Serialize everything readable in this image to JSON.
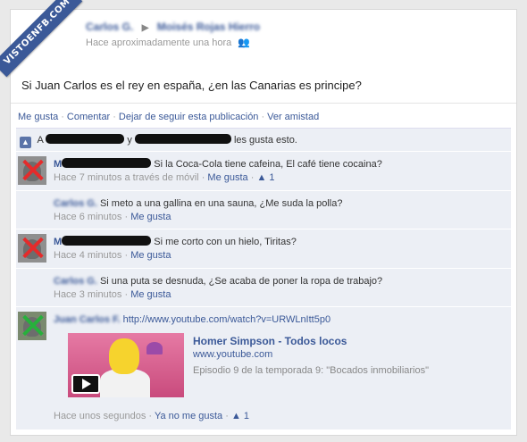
{
  "watermark": "VISTOENFB.COM",
  "post": {
    "author": "Carlos G.",
    "arrow": "▶",
    "target": "Moisés Rojas Hierro",
    "time": "Hace aproximadamente una hora",
    "status": "Si Juan Carlos es el rey en españa, ¿en las Canarias es principe?"
  },
  "actions": [
    "Me gusta",
    "Comentar",
    "Dejar de seguir esta publicación",
    "Ver amistad"
  ],
  "likes": {
    "prefix": "A",
    "joiner": "y",
    "suffix": "les gusta esto."
  },
  "comments": [
    {
      "author": "M",
      "text": "Si la Coca-Cola tiene cafeina, El café tiene cocaina?",
      "time": "Hace 7 minutos a través de móvil",
      "like": "Me gusta",
      "count": "1",
      "mark": "red"
    },
    {
      "author": "Carlos G.",
      "text": "Si meto a una gallina en una sauna, ¿Me suda la polla?",
      "time": "Hace 6 minutos",
      "like": "Me gusta"
    },
    {
      "author": "M",
      "text": "Si me corto con un hielo, Tiritas?",
      "time": "Hace 4 minutos",
      "like": "Me gusta",
      "mark": "red"
    },
    {
      "author": "Carlos G.",
      "text": "Si una puta se desnuda, ¿Se acaba de poner la ropa de trabajo?",
      "time": "Hace 3 minutos",
      "like": "Me gusta"
    },
    {
      "author": "Juan Carlos F.",
      "link": "http://www.youtube.com/watch?v=URWLnItt5p0",
      "time": "Hace unos segundos",
      "like": "Ya no me gusta",
      "count": "1",
      "mark": "green",
      "share": {
        "title": "Homer Simpson - Todos locos",
        "url": "www.youtube.com",
        "desc": "Episodio 9 de la temporada 9: \"Bocados inmobiliarios\""
      }
    }
  ],
  "colors": {
    "link": "#3b5998",
    "ufi_bg": "#eceff5",
    "red_mark": "#e52b2b",
    "green_mark": "#27b03c"
  },
  "icons": {
    "mark_red": "✕",
    "mark_green": "✕",
    "thumb": "👍",
    "friends": "👥"
  }
}
